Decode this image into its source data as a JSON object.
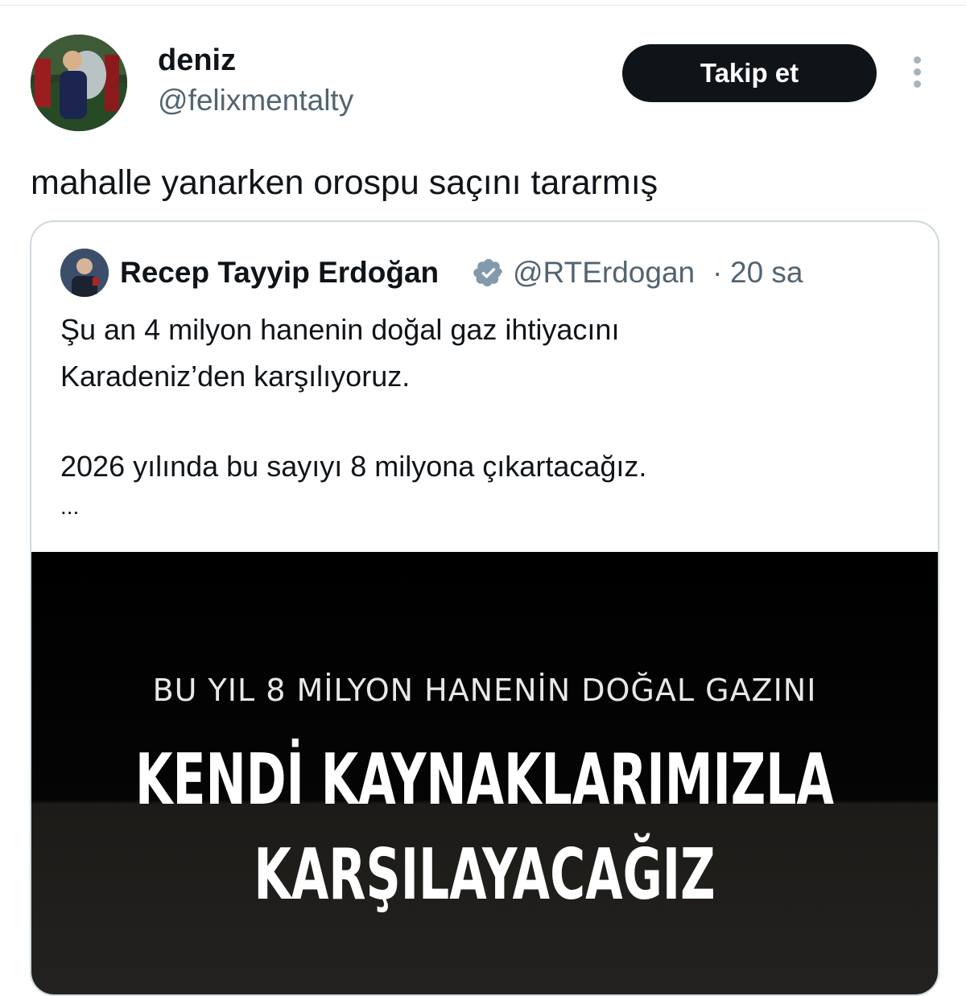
{
  "author": {
    "display_name": "deniz",
    "handle": "@felixmentalty",
    "avatar_icon": "profile-photo"
  },
  "actions": {
    "follow_label": "Takip et",
    "more_icon": "more-vertical-icon"
  },
  "tweet": {
    "text": "mahalle yanarken orospu saçını tararmış"
  },
  "quoted": {
    "display_name": "Recep Tayyip Erdoğan",
    "verified_icon": "verified-badge-icon",
    "handle": "@RTErdogan",
    "separator": "·",
    "time": "20 sa",
    "lines": [
      "Şu an 4 milyon hanenin doğal gaz ihtiyacını",
      "Karadeniz’den karşılıyoruz.",
      "2026 yılında bu sayıyı 8 milyona çıkartacağız.",
      "..."
    ],
    "media": {
      "subtitle": "BU YIL 8 MİLYON HANENİN DOĞAL GAZINI",
      "headline_1": "KENDİ KAYNAKLARIMIZLA",
      "headline_2": "KARŞILAYACAĞIZ"
    }
  },
  "colors": {
    "text_primary": "#0f1419",
    "text_secondary": "#536471",
    "follow_bg": "#0f1419",
    "border": "#cfd9de"
  }
}
